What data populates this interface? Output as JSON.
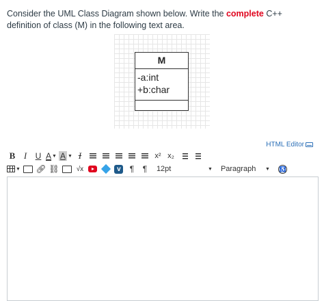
{
  "question": {
    "text_before": "Consider the UML Class Diagram shown below. Write the ",
    "highlight": "complete",
    "text_after": " C++ definition of class (M) in the following text area."
  },
  "uml": {
    "class_name": "M",
    "attributes": [
      "-a:int",
      "+b:char"
    ]
  },
  "editor": {
    "html_editor_label": "HTML Editor",
    "font_size": "12pt",
    "block_format": "Paragraph",
    "toolbar_row1": {
      "bold": "B",
      "italic": "I",
      "underline": "U",
      "font_color": "A",
      "background_color": "A",
      "clear_format": "I",
      "superscript": "x²",
      "subscript": "x₂"
    },
    "toolbar_row2": {
      "math": "√x",
      "ltr": "¶",
      "rtl": "¶",
      "accessibility": "♿"
    },
    "content": ""
  },
  "colors": {
    "highlight": "#e0061f",
    "link": "#2b6fb7",
    "text": "#2d3b45",
    "border": "#c7cdd1"
  }
}
